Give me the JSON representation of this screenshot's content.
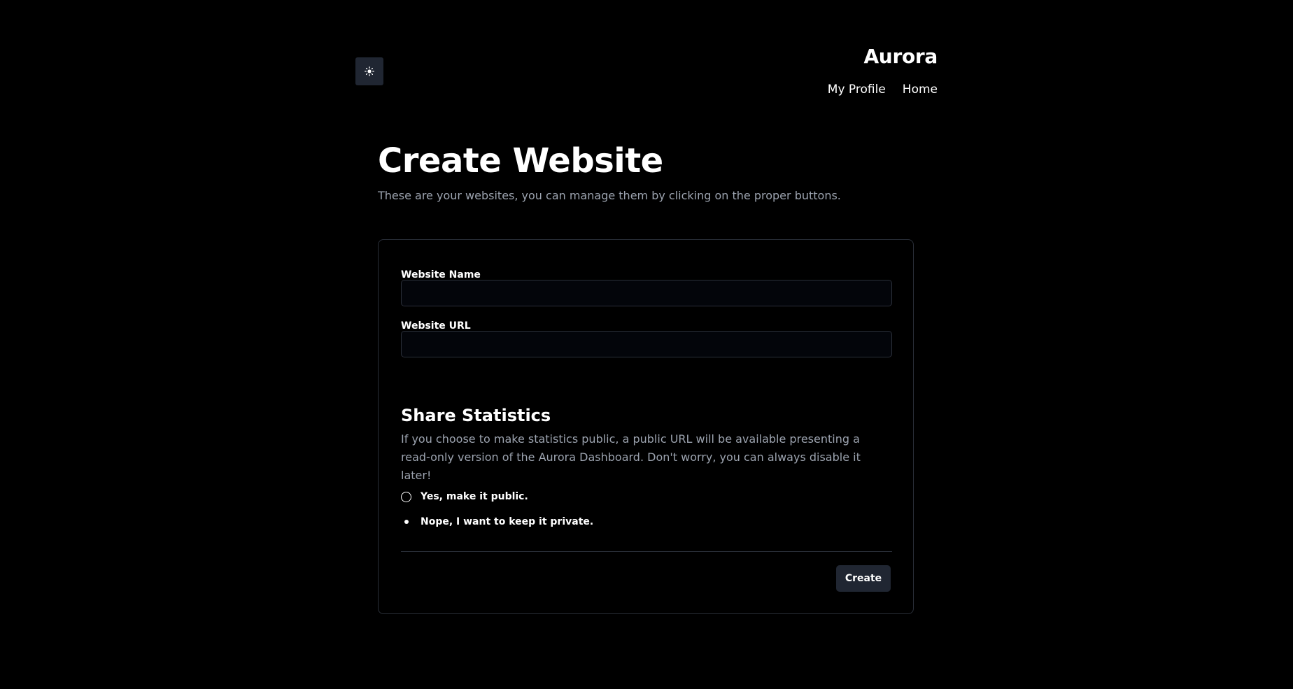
{
  "header": {
    "theme_toggle_icon": "sun-icon",
    "brand": "Aurora",
    "nav": [
      {
        "label": "My Profile"
      },
      {
        "label": "Home"
      }
    ]
  },
  "main": {
    "title": "Create Website",
    "subtitle": "These are your websites, you can manage them by clicking on the proper buttons."
  },
  "form": {
    "name_label": "Website Name",
    "name_value": "",
    "url_label": "Website URL",
    "url_value": "",
    "share_title": "Share Statistics",
    "share_description": "If you choose to make statistics public, a public URL will be available presenting a read-only version of the Aurora Dashboard. Don't worry, you can always disable it later!",
    "options": [
      {
        "label": "Yes, make it public.",
        "selected": false
      },
      {
        "label": "Nope, I want to keep it private.",
        "selected": true
      }
    ],
    "submit_label": "Create"
  },
  "colors": {
    "background": "#000000",
    "button_bg": "#202632",
    "muted_text": "#9ca3af",
    "border": "#2a2f39"
  }
}
